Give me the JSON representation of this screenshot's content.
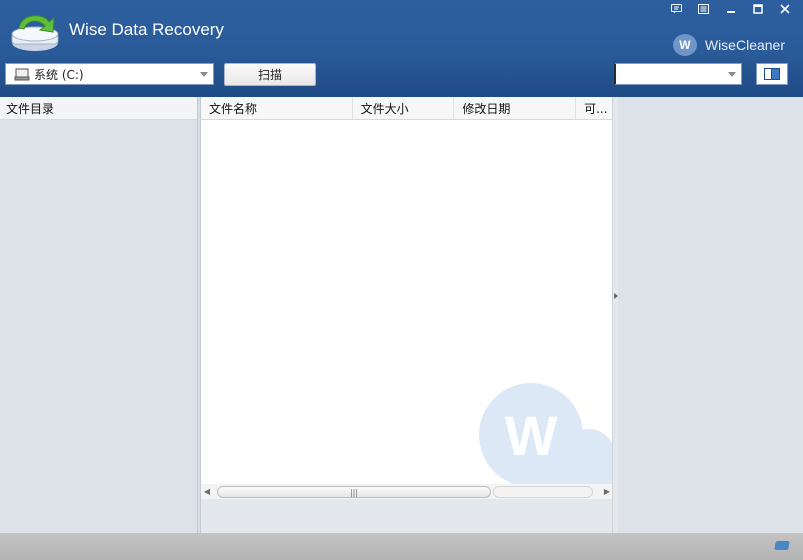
{
  "app": {
    "title": "Wise Data Recovery",
    "brand": "WiseCleaner",
    "brand_letter": "W"
  },
  "window_controls": [
    {
      "name": "feedback-icon",
      "glyph": "▣"
    },
    {
      "name": "menu-icon",
      "glyph": "☰"
    },
    {
      "name": "minimize-icon",
      "glyph": "–"
    },
    {
      "name": "maximize-icon",
      "glyph": "□"
    },
    {
      "name": "close-icon",
      "glyph": "✕"
    }
  ],
  "toolbar": {
    "drive_value": "系统 (C:)",
    "scan_label": "扫描",
    "filter_value": ""
  },
  "left_panel": {
    "header": "文件目录"
  },
  "file_list": {
    "columns": [
      "文件名称",
      "文件大小",
      "修改日期",
      "可..."
    ]
  },
  "colors": {
    "header_blue": "#2a5a98",
    "accent": "#3c79c2"
  }
}
